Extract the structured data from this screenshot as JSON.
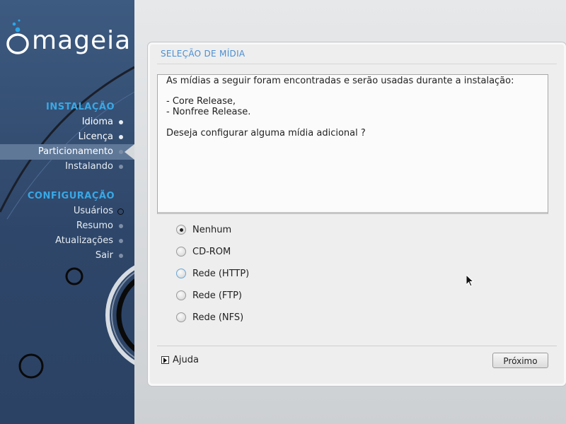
{
  "sidebar": {
    "logo_text": "mageia",
    "sections": [
      {
        "title": "INSTALAÇÃO",
        "steps": [
          "Idioma",
          "Licença",
          "Particionamento",
          "Instalando"
        ]
      },
      {
        "title": "CONFIGURAÇÃO",
        "steps": [
          "Usuários",
          "Resumo",
          "Atualizações",
          "Sair"
        ]
      }
    ],
    "active_step": "Particionamento"
  },
  "panel": {
    "title": "SELEÇÃO DE MÍDIA",
    "message_lines": [
      "As mídias a seguir foram encontradas e serão usadas durante a instalação:",
      "- Core Release,",
      "- Nonfree Release.",
      "Deseja configurar alguma mídia adicional ?"
    ],
    "options": [
      "Nenhum",
      "CD-ROM",
      "Rede (HTTP)",
      "Rede (FTP)",
      "Rede (NFS)"
    ],
    "selected_option": "Nenhum",
    "help_label": "Ajuda",
    "next_label": "Próximo"
  },
  "colors": {
    "sidebar_bg": "#2e4669",
    "section_title": "#38a8e6",
    "panel_title": "#4a8ed3",
    "active_step_bg": "#5f7898"
  }
}
